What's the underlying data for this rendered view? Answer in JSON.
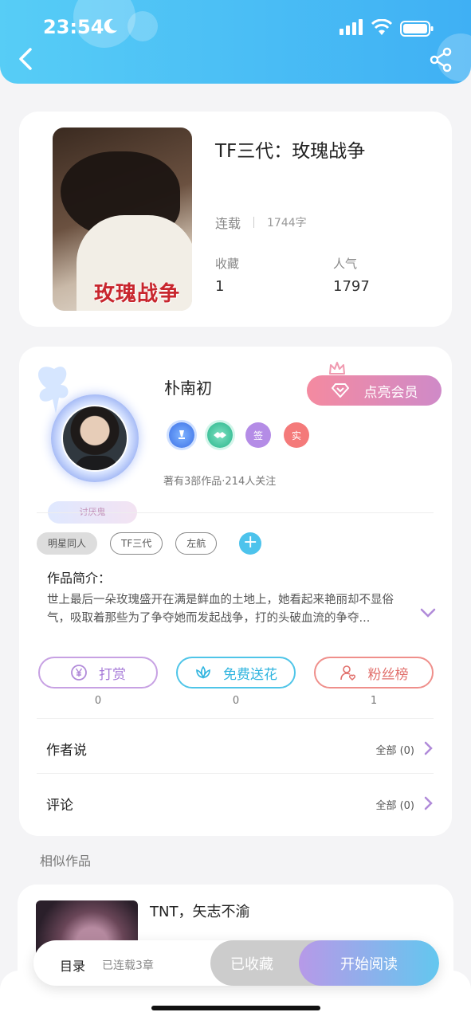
{
  "status_bar": {
    "time": "23:54"
  },
  "colors": {
    "accent": "#3fb0f4",
    "vip_start": "#f48aa0",
    "vip_end": "#cf8ac8",
    "read_start": "#b799e8",
    "read_end": "#63c7ef"
  },
  "book": {
    "cover_title": "玫瑰战争",
    "title": "TF三代：玫瑰战争",
    "status": "连载",
    "word_count": "1744字",
    "favorites_label": "收藏",
    "favorites_value": "1",
    "popularity_label": "人气",
    "popularity_value": "1797"
  },
  "author": {
    "name": "朴南初",
    "tag": "讨厌鬼",
    "vip_button": "点亮会员",
    "badges": [
      "",
      "",
      "签",
      "实"
    ],
    "meta": "著有3部作品·214人关注"
  },
  "tags": [
    "明星同人",
    "TF三代",
    "左航"
  ],
  "intro": {
    "label": "作品简介：",
    "text": "世上最后一朵玫瑰盛开在满是鲜血的土地上，她看起来艳丽却不显俗气，吸取着那些为了争夺她而发起战争，打的头破血流的争夺..."
  },
  "actions": [
    {
      "label": "打赏",
      "count": "0"
    },
    {
      "label": "免费送花",
      "count": "0"
    },
    {
      "label": "粉丝榜",
      "count": "1"
    }
  ],
  "links": [
    {
      "label": "作者说",
      "more": "全部 (0)"
    },
    {
      "label": "评论",
      "more": "全部 (0)"
    }
  ],
  "similar": {
    "heading": "相似作品",
    "items": [
      {
        "title": "TNT，矢志不渝"
      }
    ]
  },
  "bottom_bar": {
    "toc_label": "目录",
    "toc_status": "已连载3章",
    "fav_button": "已收藏",
    "read_button": "开始阅读"
  }
}
